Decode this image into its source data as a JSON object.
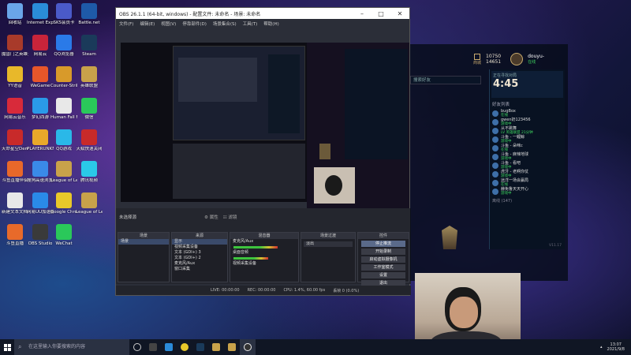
{
  "desktop": {
    "icons": [
      {
        "label": "回收站",
        "color": "#6aa6e8"
      },
      {
        "label": "Internet Explorer",
        "color": "#2a8cd8"
      },
      {
        "label": "SKS会员卡",
        "color": "#4a5ac8"
      },
      {
        "label": "Battle.net",
        "color": "#1e5aa8"
      },
      {
        "label": "魔兽门之英雄无敌3",
        "color": "#a83a2a"
      },
      {
        "label": "网易云",
        "color": "#c8243a"
      },
      {
        "label": "QQ浏览器",
        "color": "#2a7ae8"
      },
      {
        "label": "Steam",
        "color": "#1a3a5a"
      },
      {
        "label": "YY语音",
        "color": "#e8b82a"
      },
      {
        "label": "WeGame",
        "color": "#e8562a"
      },
      {
        "label": "Counter-Strike: Global Off...",
        "color": "#d89a2a"
      },
      {
        "label": "英雄联盟",
        "color": "#c8a24a"
      },
      {
        "label": "网易云音乐",
        "color": "#d82a3a"
      },
      {
        "label": "梦幻西游",
        "color": "#2a9ae8"
      },
      {
        "label": "Human Fall Flat",
        "color": "#e8e8e8"
      },
      {
        "label": "微信",
        "color": "#2ac85a"
      },
      {
        "label": "天命星空Demo",
        "color": "#c82a2a"
      },
      {
        "label": "PLAYERUNKNOWN'S BATTLEGR...",
        "color": "#e8a82a"
      },
      {
        "label": "QQ游戏",
        "color": "#2ab8e8"
      },
      {
        "label": "天赋快速关闭",
        "color": "#c82a2a"
      },
      {
        "label": "斗鱼直播伴侣",
        "color": "#e8682a"
      },
      {
        "label": "搜狗高速浏览器",
        "color": "#3a8ae8"
      },
      {
        "label": "League of Legends",
        "color": "#c8a24a"
      },
      {
        "label": "腾讯视频",
        "color": "#2ac8e8"
      },
      {
        "label": "新建文本文档 (2).txt",
        "color": "#e8e8e8"
      },
      {
        "label": "网易UU加速器",
        "color": "#2a8ae8"
      },
      {
        "label": "Google Chrome",
        "color": "#e8c82a"
      },
      {
        "label": "League of Legends 快捷方式",
        "color": "#c8a24a"
      },
      {
        "label": "斗鱼直播",
        "color": "#e86a2a"
      },
      {
        "label": "OBS Studio",
        "color": "#3a3a3a"
      },
      {
        "label": "WeChat",
        "color": "#2ac85a"
      }
    ]
  },
  "obs": {
    "title": "OBS 26.1.1 (64-bit, windows) - 配置文件: 未命名 - 场景: 未命名",
    "menu": [
      "文件(F)",
      "编辑(E)",
      "视图(V)",
      "停靠部件(D)",
      "场景集合(S)",
      "工具(T)",
      "帮助(H)"
    ],
    "preview_label": "未选择源",
    "properties_btn": "属性",
    "filters_btn": "滤镜",
    "scenes_header": "场景",
    "scenes": [
      "场景"
    ],
    "sources_header": "来源",
    "sources": [
      "显示",
      "视频采集设备",
      "文本 (GDI+) 3",
      "文本 (GDI+) 2",
      "麦克风/Aux",
      "窗口采集"
    ],
    "mixer_header": "混音器",
    "mixer": [
      {
        "name": "麦克风/Aux",
        "level": 0.7
      },
      {
        "name": "桌面音频",
        "level": 0.55
      },
      {
        "name": "视频采集设备",
        "level": 0.0
      }
    ],
    "transitions_header": "场景过渡",
    "transition_value": "淡出",
    "controls_header": "控件",
    "controls": [
      "停止推流",
      "开始录制",
      "启动虚拟摄像机",
      "工作室模式",
      "设置",
      "退出"
    ],
    "status": {
      "live": "LIVE: 00:00:00",
      "rec": "REC: 00:00:00",
      "cpu": "CPU: 1.4%, 60.00 fps",
      "dropped": "丢帧 0 (0.0%)"
    }
  },
  "lol": {
    "currency_rp": "10750",
    "currency_be": "14651",
    "username": "douyu-",
    "search_placeholder": "搜索好友",
    "shop_label": "商城",
    "status_text": "在线",
    "timer": "4:45",
    "queue_label": "正在寻找对局",
    "friends_header": "好友列表",
    "friends": [
      {
        "name": "bugBox",
        "status": "在线"
      },
      {
        "name": "gwen奶123456",
        "status": "游戏中"
      },
      {
        "name": "从不跳舞",
        "status": "LV 英雄联盟 21分钟"
      },
      {
        "name": "斗鱼 - 一鲤鲸",
        "status": "游戏中"
      },
      {
        "name": "斗鱼 - 朵咪c",
        "status": "在线"
      },
      {
        "name": "斗鱼 - 麻辣地球",
        "status": "游戏中"
      },
      {
        "name": "斗鱼 - 看吧",
        "status": "游戏中"
      },
      {
        "name": "虎牙 - 老啊你仗",
        "status": "游戏中"
      },
      {
        "name": "远洋一场会赢局",
        "status": "在线"
      },
      {
        "name": "赫免鲁天天开心",
        "status": "游戏中"
      }
    ],
    "friends_footer": "离线 (147)",
    "version": "V11.17"
  },
  "taskbar": {
    "search_placeholder": "在这里输入你要搜索的内容",
    "time": "13:07",
    "date": "2021/9/8"
  }
}
